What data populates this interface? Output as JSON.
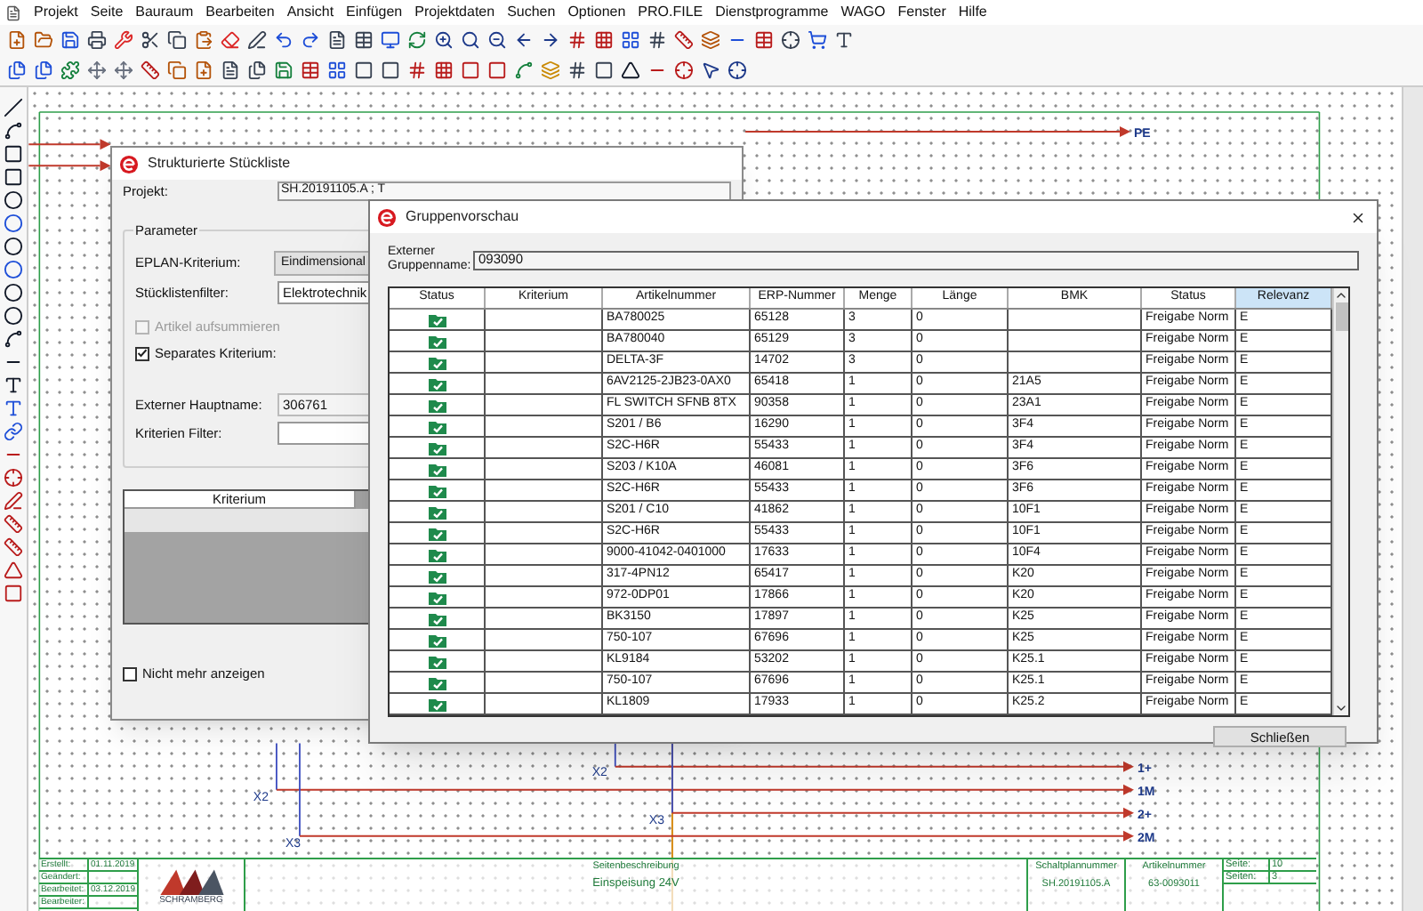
{
  "menu": [
    "Projekt",
    "Seite",
    "Bauraum",
    "Bearbeiten",
    "Ansicht",
    "Einfügen",
    "Projektdaten",
    "Suchen",
    "Optionen",
    "PRO.FILE",
    "Dienstprogramme",
    "WAGO",
    "Fenster",
    "Hilfe"
  ],
  "schematic": {
    "pe_label": "PE",
    "terminal_labels": [
      "X2",
      "X2",
      "X3",
      "X3"
    ],
    "outputs": [
      "1+",
      "1M",
      "2+",
      "2M"
    ]
  },
  "title_block": {
    "left_rows": [
      {
        "label": "Erstellt:",
        "value": "01.11.2019"
      },
      {
        "label": "Geändert:"
      },
      {
        "label": "Bearbeitet:",
        "value": "03.12.2019"
      },
      {
        "label": "Bearbeiter:"
      }
    ],
    "logo_text": "SCHRAMBERG",
    "description_label": "Seitenbeschreibung",
    "description": "Einspeisung 24V",
    "plan_label": "Schaltplannummer",
    "plan_value": "SH.20191105.A",
    "article_label": "Artikelnummer",
    "article_value": "63-0093011",
    "page_rows": [
      {
        "label": "Seite:",
        "value": "10"
      },
      {
        "label": "Seiten:",
        "value": "3"
      }
    ]
  },
  "left_dialog": {
    "title": "Strukturierte Stückliste",
    "project_label": "Projekt:",
    "project_value": "SH.20191105.A ; T",
    "group_title": "Parameter",
    "criterion_label": "EPLAN-Kriterium:",
    "criterion_button": "Eindimensional",
    "filter_label": "Stücklistenfilter:",
    "filter_value": "Elektrotechnik",
    "checkboxes": [
      {
        "label": "Artikel aufsummieren",
        "checked": false,
        "disabled": true
      },
      {
        "label": "Separates Kriterium:",
        "checked": true,
        "disabled": false
      }
    ],
    "main_name_label": "Externer Hauptname:",
    "main_name_value": "306761",
    "criteria_filter_label": "Kriterien Filter:",
    "table_header": "Kriterium",
    "footer_checkbox": {
      "label": "Nicht mehr anzeigen",
      "checked": false
    }
  },
  "group_dialog": {
    "title": "Gruppenvorschau",
    "name_label": "Externer Gruppenname:",
    "name_value": "093090",
    "columns": [
      {
        "label": "Status",
        "selected": false
      },
      {
        "label": "Kriterium",
        "selected": false
      },
      {
        "label": "Artikelnummer",
        "selected": false
      },
      {
        "label": "ERP-Nummer",
        "selected": false
      },
      {
        "label": "Menge",
        "selected": false
      },
      {
        "label": "Länge",
        "selected": false
      },
      {
        "label": "BMK",
        "selected": false
      },
      {
        "label": "Status",
        "selected": false
      },
      {
        "label": "Relevanz",
        "selected": true
      }
    ],
    "rows": [
      {
        "approved": true,
        "artikelnummer": "BA780025",
        "erp_nummer": "65128",
        "menge": "3",
        "laenge": "0",
        "status": "Freigabe Norm",
        "relevanz": "E"
      },
      {
        "approved": true,
        "artikelnummer": "BA780040",
        "erp_nummer": "65129",
        "menge": "3",
        "laenge": "0",
        "status": "Freigabe Norm",
        "relevanz": "E"
      },
      {
        "approved": true,
        "artikelnummer": "DELTA-3F",
        "erp_nummer": "14702",
        "menge": "3",
        "laenge": "0",
        "status": "Freigabe Norm",
        "relevanz": "E"
      },
      {
        "approved": true,
        "artikelnummer": "6AV2125-2JB23-0AX0",
        "erp_nummer": "65418",
        "menge": "1",
        "laenge": "0",
        "bmk": "21A5",
        "status": "Freigabe Norm",
        "relevanz": "E"
      },
      {
        "approved": true,
        "artikelnummer": "FL SWITCH SFNB 8TX",
        "erp_nummer": "90358",
        "menge": "1",
        "laenge": "0",
        "bmk": "23A1",
        "status": "Freigabe Norm",
        "relevanz": "E"
      },
      {
        "approved": true,
        "artikelnummer": "S201 / B6",
        "erp_nummer": "16290",
        "menge": "1",
        "laenge": "0",
        "bmk": "3F4",
        "status": "Freigabe Norm",
        "relevanz": "E"
      },
      {
        "approved": true,
        "artikelnummer": "S2C-H6R",
        "erp_nummer": "55433",
        "menge": "1",
        "laenge": "0",
        "bmk": "3F4",
        "status": "Freigabe Norm",
        "relevanz": "E"
      },
      {
        "approved": true,
        "artikelnummer": "S203 / K10A",
        "erp_nummer": "46081",
        "menge": "1",
        "laenge": "0",
        "bmk": "3F6",
        "status": "Freigabe Norm",
        "relevanz": "E"
      },
      {
        "approved": true,
        "artikelnummer": "S2C-H6R",
        "erp_nummer": "55433",
        "menge": "1",
        "laenge": "0",
        "bmk": "3F6",
        "status": "Freigabe Norm",
        "relevanz": "E"
      },
      {
        "approved": true,
        "artikelnummer": "S201 / C10",
        "erp_nummer": "41862",
        "menge": "1",
        "laenge": "0",
        "bmk": "10F1",
        "status": "Freigabe Norm",
        "relevanz": "E"
      },
      {
        "approved": true,
        "artikelnummer": "S2C-H6R",
        "erp_nummer": "55433",
        "menge": "1",
        "laenge": "0",
        "bmk": "10F1",
        "status": "Freigabe Norm",
        "relevanz": "E"
      },
      {
        "approved": true,
        "artikelnummer": "9000-41042-0401000",
        "erp_nummer": "17633",
        "menge": "1",
        "laenge": "0",
        "bmk": "10F4",
        "status": "Freigabe Norm",
        "relevanz": "E"
      },
      {
        "approved": true,
        "artikelnummer": "317-4PN12",
        "erp_nummer": "65417",
        "menge": "1",
        "laenge": "0",
        "bmk": "K20",
        "status": "Freigabe Norm",
        "relevanz": "E"
      },
      {
        "approved": true,
        "artikelnummer": "972-0DP01",
        "erp_nummer": "17866",
        "menge": "1",
        "laenge": "0",
        "bmk": "K20",
        "status": "Freigabe Norm",
        "relevanz": "E"
      },
      {
        "approved": true,
        "artikelnummer": "BK3150",
        "erp_nummer": "17897",
        "menge": "1",
        "laenge": "0",
        "bmk": "K25",
        "status": "Freigabe Norm",
        "relevanz": "E"
      },
      {
        "approved": true,
        "artikelnummer": "750-107",
        "erp_nummer": "67696",
        "menge": "1",
        "laenge": "0",
        "bmk": "K25",
        "status": "Freigabe Norm",
        "relevanz": "E"
      },
      {
        "approved": true,
        "artikelnummer": "KL9184",
        "erp_nummer": "53202",
        "menge": "1",
        "laenge": "0",
        "bmk": "K25.1",
        "status": "Freigabe Norm",
        "relevanz": "E"
      },
      {
        "approved": true,
        "artikelnummer": "750-107",
        "erp_nummer": "67696",
        "menge": "1",
        "laenge": "0",
        "bmk": "K25.1",
        "status": "Freigabe Norm",
        "relevanz": "E"
      },
      {
        "approved": true,
        "artikelnummer": "KL1809",
        "erp_nummer": "17933",
        "menge": "1",
        "laenge": "0",
        "bmk": "K25.2",
        "status": "Freigabe Norm",
        "relevanz": "E"
      }
    ],
    "close_button": "Schließen"
  }
}
